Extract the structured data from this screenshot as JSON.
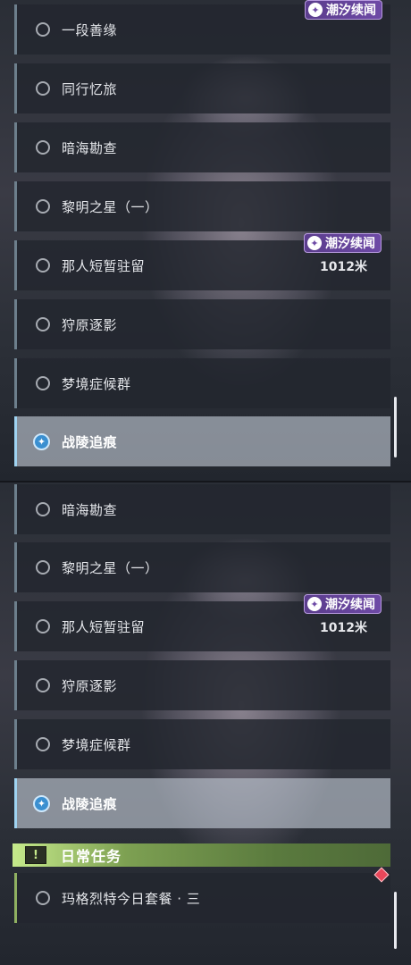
{
  "top": {
    "quests": [
      {
        "label": "一段善缘"
      },
      {
        "label": "同行忆旅"
      },
      {
        "label": "暗海勘查"
      },
      {
        "label": "黎明之星（一）"
      },
      {
        "label": "那人短暂驻留"
      },
      {
        "label": "狩原逐影"
      },
      {
        "label": "梦境症候群"
      },
      {
        "label": "战陵追痕"
      }
    ],
    "badge_first": "潮汐续闻",
    "badge_second": "潮汐续闻",
    "distance": "1012米"
  },
  "bottom": {
    "quests": [
      {
        "label": "暗海勘查"
      },
      {
        "label": "黎明之星（一）"
      },
      {
        "label": "那人短暂驻留"
      },
      {
        "label": "狩原逐影"
      },
      {
        "label": "梦境症候群"
      },
      {
        "label": "战陵追痕"
      }
    ],
    "badge": "潮汐续闻",
    "distance": "1012米",
    "section_title": "日常任务",
    "section_icon": "!",
    "daily_quest": "玛格烈特今日套餐 · 三"
  },
  "colors": {
    "accent_active": "#9fd3f1",
    "badge": "#6e4aa6",
    "daily_green": "#8fb061",
    "alert_red": "#e8475a"
  }
}
